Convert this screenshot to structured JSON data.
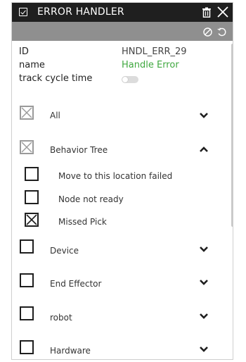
{
  "header": {
    "title": "ERROR HANDLER",
    "icons": [
      "checkbox-icon",
      "trash-icon",
      "close-icon"
    ]
  },
  "toolbar": {
    "icons": [
      "ban-icon",
      "reset-icon"
    ]
  },
  "properties": {
    "id_label": "ID",
    "id_value": "HNDL_ERR_29",
    "name_label": "name",
    "name_value": "Handle Error",
    "name_value_color": "#3fa83f",
    "track_label": "track cycle time",
    "track_enabled": false
  },
  "categories": [
    {
      "label": "All",
      "checked": true,
      "disabled": true,
      "expanded": false
    },
    {
      "label": "Behavior Tree",
      "checked": true,
      "disabled": true,
      "expanded": true,
      "children": [
        {
          "label": "Move to this location failed",
          "checked": false
        },
        {
          "label": "Node not ready",
          "checked": false
        },
        {
          "label": "Missed Pick",
          "checked": true
        }
      ]
    },
    {
      "label": "Device",
      "checked": false,
      "expanded": false
    },
    {
      "label": "End Effector",
      "checked": false,
      "expanded": false
    },
    {
      "label": "robot",
      "checked": false,
      "expanded": false
    },
    {
      "label": "Hardware",
      "checked": false,
      "expanded": false
    }
  ]
}
